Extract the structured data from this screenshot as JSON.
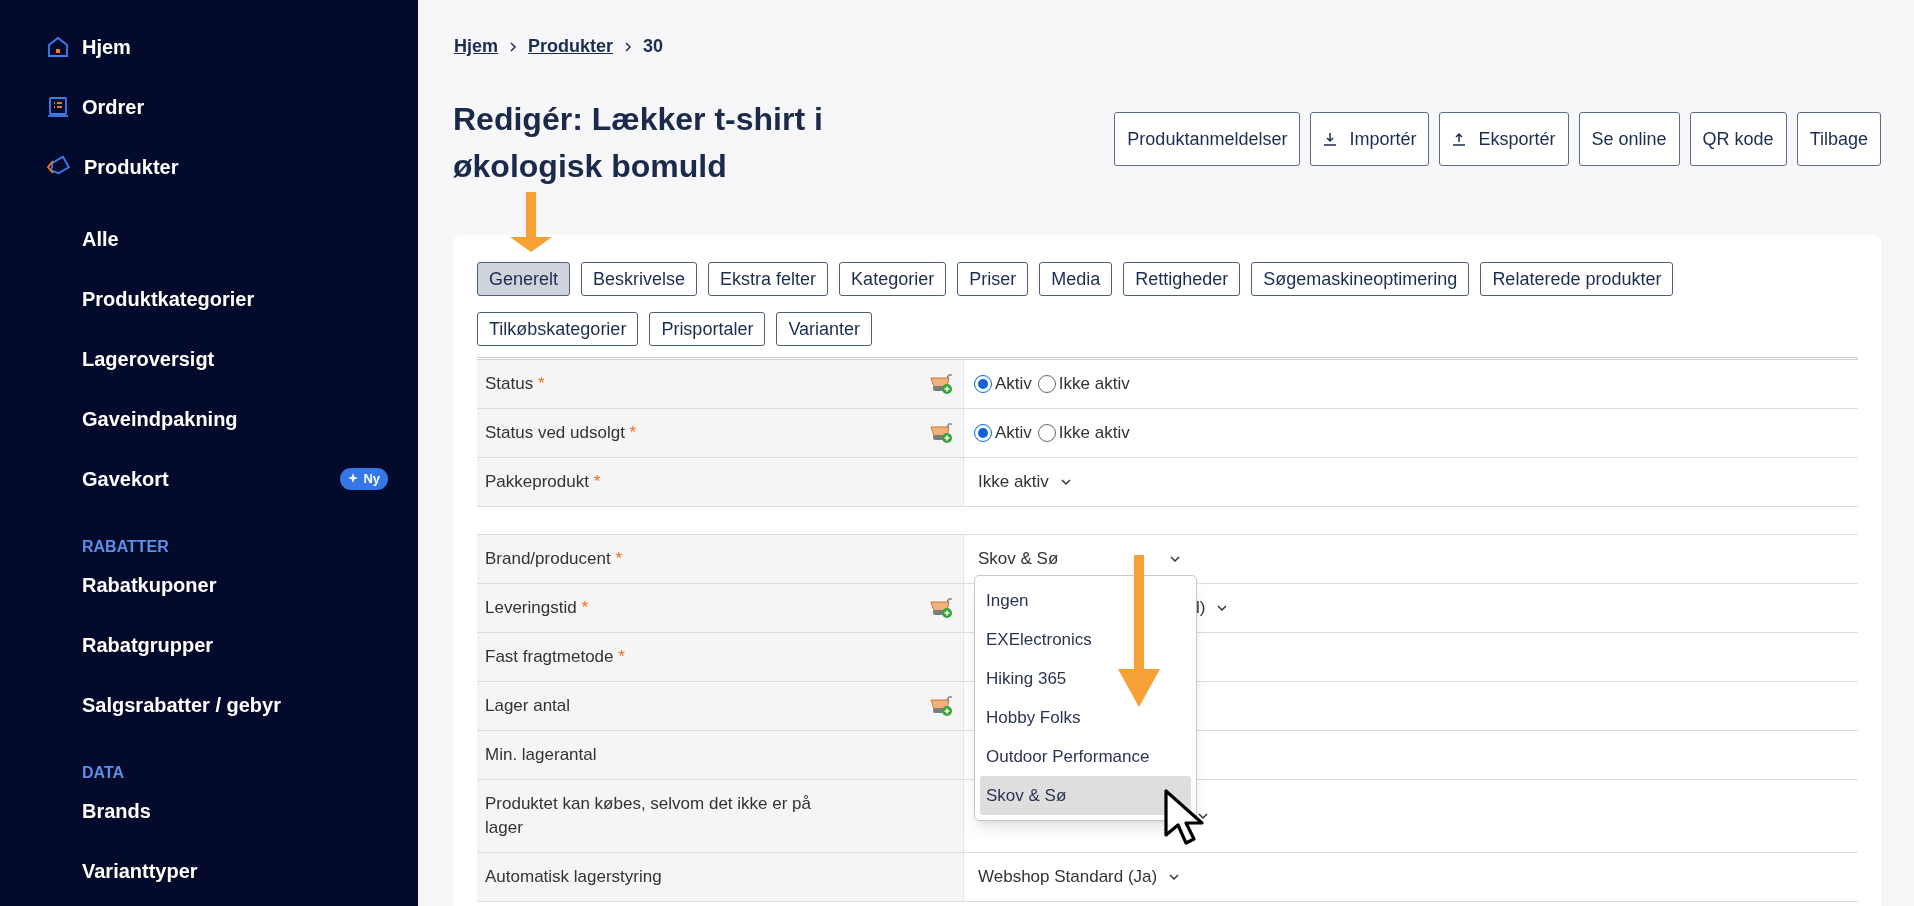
{
  "sidebar": {
    "items": [
      {
        "kind": "home",
        "label": "Hjem"
      },
      {
        "kind": "orders",
        "label": "Ordrer"
      },
      {
        "kind": "products",
        "label": "Produkter"
      },
      {
        "kind": "sub",
        "label": "Alle"
      },
      {
        "kind": "sub",
        "label": "Produktkategorier"
      },
      {
        "kind": "sub",
        "label": "Lageroversigt"
      },
      {
        "kind": "sub",
        "label": "Gaveindpakning"
      },
      {
        "kind": "sub",
        "label": "Gavekort",
        "badge": "Ny"
      },
      {
        "kind": "heading",
        "label": "RABATTER"
      },
      {
        "kind": "sub",
        "label": "Rabatkuponer"
      },
      {
        "kind": "sub",
        "label": "Rabatgrupper"
      },
      {
        "kind": "sub",
        "label": "Salgsrabatter / gebyr"
      },
      {
        "kind": "heading",
        "label": "DATA"
      },
      {
        "kind": "sub",
        "label": "Brands"
      },
      {
        "kind": "sub",
        "label": "Varianttyper"
      }
    ]
  },
  "breadcrumb": [
    {
      "label": "Hjem",
      "link": true
    },
    {
      "label": "Produkter",
      "link": true
    },
    {
      "label": "30",
      "link": false
    }
  ],
  "title": "Redigér: Lækker t-shirt i økologisk bomuld",
  "header_buttons": [
    {
      "kind": "text",
      "label": "Produktanmeldelser"
    },
    {
      "kind": "download",
      "label": "Importér"
    },
    {
      "kind": "upload",
      "label": "Eksportér"
    },
    {
      "kind": "text",
      "label": "Se online"
    },
    {
      "kind": "text",
      "label": "QR kode"
    },
    {
      "kind": "text",
      "label": "Tilbage"
    }
  ],
  "tabs": [
    {
      "label": "Generelt",
      "selected": true
    },
    {
      "label": "Beskrivelse",
      "selected": false
    },
    {
      "label": "Ekstra felter",
      "selected": false
    },
    {
      "label": "Kategorier",
      "selected": false
    },
    {
      "label": "Priser",
      "selected": false
    },
    {
      "label": "Media",
      "selected": false
    },
    {
      "label": "Rettigheder",
      "selected": false
    },
    {
      "label": "Søgemaskineoptimering",
      "selected": false
    },
    {
      "label": "Relaterede produkter",
      "selected": false
    },
    {
      "label": "Tilkøbskategorier",
      "selected": false
    },
    {
      "label": "Prisportaler",
      "selected": false
    },
    {
      "label": "Varianter",
      "selected": false
    }
  ],
  "rows": [
    {
      "label": "Status",
      "required_mark": "*",
      "basket_icon": true,
      "new_group": false,
      "kind": "radio",
      "options": [
        {
          "label": "Aktiv",
          "selected": true
        },
        {
          "label": "Ikke aktiv",
          "selected": false
        }
      ]
    },
    {
      "label": "Status ved udsolgt",
      "required_mark": "*",
      "basket_icon": true,
      "new_group": false,
      "kind": "radio",
      "options": [
        {
          "label": "Aktiv",
          "selected": true
        },
        {
          "label": "Ikke aktiv",
          "selected": false
        }
      ]
    },
    {
      "label": "Pakkeprodukt",
      "required_mark": "*",
      "basket_icon": false,
      "new_group": false,
      "kind": "select",
      "value": "Ikke aktiv"
    },
    {
      "label": "Brand/producent",
      "required_mark": "*",
      "basket_icon": false,
      "new_group": true,
      "kind": "select",
      "value": "Skov & Sø",
      "dropdown": {
        "options": [
          {
            "label": "Ingen",
            "selected": false
          },
          {
            "label": "EXElectronics",
            "selected": false
          },
          {
            "label": "Hiking 365",
            "selected": false
          },
          {
            "label": "Hobby Folks",
            "selected": false
          },
          {
            "label": "Outdoor Performance",
            "selected": false
          },
          {
            "label": "Skov & Sø",
            "selected": true
          }
        ]
      }
    },
    {
      "label": "Leveringstid",
      "required_mark": "*",
      "basket_icon": true,
      "new_group": false,
      "kind": "covered_select",
      "value": "l)"
    },
    {
      "label": "Fast fragtmetode",
      "required_mark": "*",
      "basket_icon": false,
      "new_group": false,
      "kind": "empty"
    },
    {
      "label": "Lager antal",
      "basket_icon": true,
      "new_group": false,
      "kind": "empty"
    },
    {
      "label": "Min. lagerantal",
      "basket_icon": false,
      "new_group": false,
      "kind": "empty"
    },
    {
      "label": "Produktet kan købes, selvom det ikke er på lager",
      "basket_icon": false,
      "new_group": false,
      "kind": "covered_select"
    },
    {
      "label": "Automatisk lagerstyring",
      "basket_icon": false,
      "new_group": false,
      "kind": "select",
      "value": "Webshop Standard (Ja)"
    }
  ]
}
